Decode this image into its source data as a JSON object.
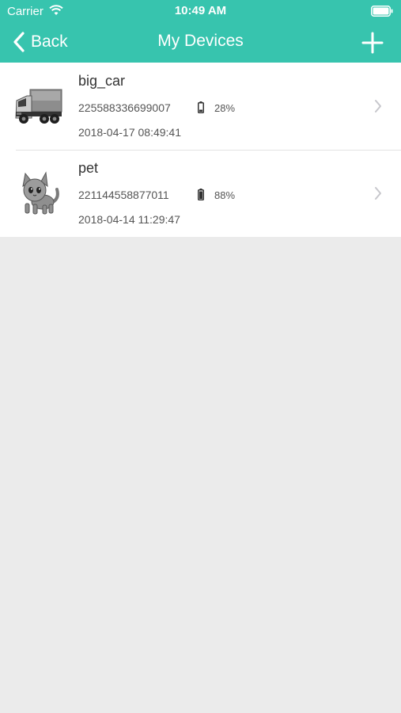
{
  "status_bar": {
    "carrier": "Carrier",
    "time": "10:49 AM"
  },
  "nav": {
    "back_label": "Back",
    "title": "My Devices",
    "add_icon": "plus-icon",
    "back_icon": "chevron-left-icon"
  },
  "colors": {
    "header": "#37c4ae",
    "background": "#ebebeb"
  },
  "devices": [
    {
      "name": "big_car",
      "id": "225588336699007",
      "battery": "28%",
      "battery_level": 0.28,
      "timestamp": "2018-04-17 08:49:41",
      "icon": "truck-icon"
    },
    {
      "name": "pet",
      "id": "221144558877011",
      "battery": "88%",
      "battery_level": 0.88,
      "timestamp": "2018-04-14 11:29:47",
      "icon": "cat-icon"
    }
  ]
}
